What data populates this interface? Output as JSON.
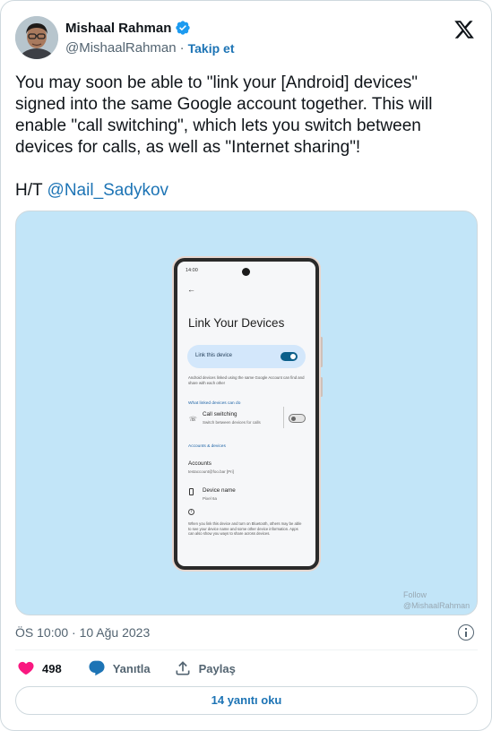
{
  "author": {
    "name": "Mishaal Rahman",
    "handle": "@MishaalRahman",
    "separator": "·",
    "follow_label": "Takip et"
  },
  "tweet": {
    "text": "You may soon be able to \"link your [Android] devices\"\nsigned into the same Google account together. This will\nenable \"call switching\", which lets you switch between\ndevices for calls, as well as \"Internet sharing\"!",
    "ht_prefix": "H/T ",
    "ht_mention": "@Nail_Sadykov"
  },
  "media": {
    "status_time": "14:00",
    "back_glyph": "←",
    "screen_title": "Link Your Devices",
    "link_toggle_label": "Link this device",
    "description": "Android devices linked using the same Google Account can find and share with each other",
    "section_can_do": "What linked devices can do",
    "call_switching_title": "Call switching",
    "call_switching_sub": "Switch between devices for calls",
    "section_accounts": "Accounts & devices",
    "accounts_title": "Accounts",
    "accounts_sub": "testaccount@foo.bar [Pri]",
    "device_name_title": "Device name",
    "device_name_sub": "Pixel 6a",
    "info_glyph": "i",
    "footer_text": "When you link this device and turn on Bluetooth, others may be able to see your device name and some other device information. Apps can also show you ways to share across devices.",
    "watermark_line1": "Follow",
    "watermark_line2": "@MishaalRahman"
  },
  "meta": {
    "timestamp": "ÖS 10:00 · 10 Ağu 2023"
  },
  "actions": {
    "like_count": "498",
    "reply_label": "Yanıtla",
    "share_label": "Paylaş"
  },
  "footer": {
    "read_replies_label": "14 yanıtı oku"
  },
  "colors": {
    "accent": "#1d74b5",
    "like": "#f91880",
    "media_bg": "#c2e5f8"
  },
  "icons": [
    "verified-badge-icon",
    "x-logo-icon",
    "heart-icon",
    "reply-bubble-icon",
    "share-icon",
    "info-icon"
  ]
}
